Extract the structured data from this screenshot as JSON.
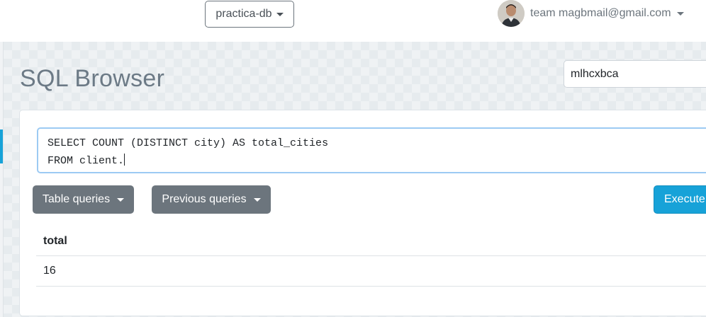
{
  "header": {
    "database": "practica-db",
    "user_label": "team magbmail@gmail.com"
  },
  "page": {
    "title": "SQL Browser",
    "search_value": "mlhcxbca"
  },
  "editor": {
    "line1": "SELECT COUNT (DISTINCT city) AS total_cities",
    "line2": "FROM client."
  },
  "toolbar": {
    "table_queries": "Table queries",
    "previous_queries": "Previous queries",
    "execute": "Execute"
  },
  "results": {
    "columns": [
      "total"
    ],
    "rows": [
      [
        "16"
      ]
    ]
  },
  "colors": {
    "primary": "#17a2d8",
    "secondary": "#6c757d"
  }
}
